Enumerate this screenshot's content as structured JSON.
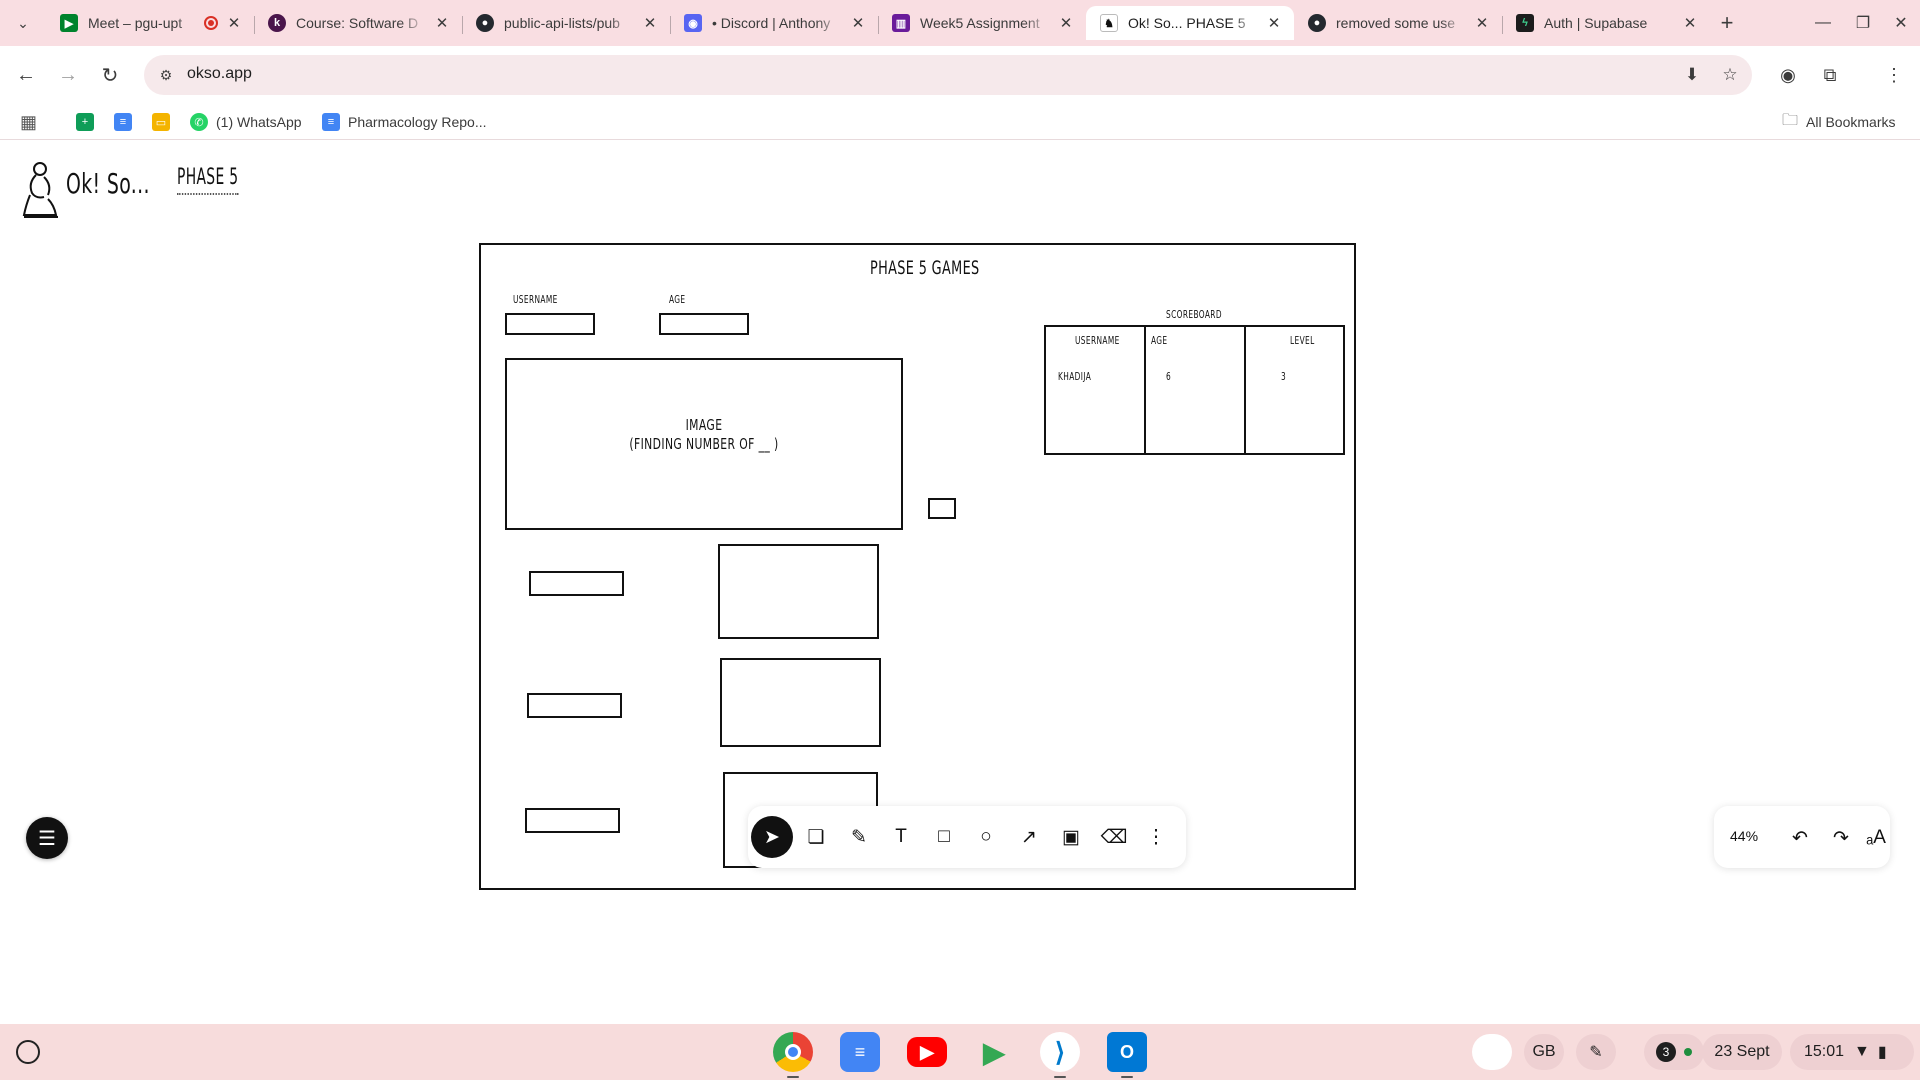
{
  "browser": {
    "tabs": [
      {
        "title": "Meet – pgu-upt",
        "favicon_color": "#00832d",
        "icon": "meet-icon"
      },
      {
        "title": "Course: Software D",
        "favicon_color": "#4a154b",
        "icon": "course-icon"
      },
      {
        "title": "public-api-lists/pub",
        "favicon_color": "#24292f",
        "icon": "github-icon"
      },
      {
        "title": "• Discord | Anthony",
        "favicon_color": "#5865f2",
        "icon": "discord-icon"
      },
      {
        "title": "Week5 Assignment",
        "favicon_color": "#6a1b9a",
        "icon": "doc-icon"
      },
      {
        "title": "Ok! So... PHASE 5",
        "favicon_color": "#ffffff",
        "icon": "okso-icon"
      },
      {
        "title": "removed some use",
        "favicon_color": "#24292f",
        "icon": "github-icon"
      },
      {
        "title": "Auth | Supabase",
        "favicon_color": "#1c1c1c",
        "icon": "supabase-icon"
      }
    ],
    "active_tab_index": 5,
    "url": "okso.app",
    "bookmarks": [
      {
        "label": "",
        "icon": "apps-grid-icon"
      },
      {
        "label": "",
        "icon": "sheets-icon",
        "color": "#0f9d58"
      },
      {
        "label": "",
        "icon": "docs-icon",
        "color": "#4285f4"
      },
      {
        "label": "",
        "icon": "slides-icon",
        "color": "#f4b400"
      },
      {
        "label": "(1) WhatsApp",
        "icon": "whatsapp-icon",
        "color": "#25d366"
      },
      {
        "label": "Pharmacology Repo...",
        "icon": "docs-icon",
        "color": "#4285f4"
      }
    ],
    "all_bookmarks_label": "All Bookmarks"
  },
  "app": {
    "brand": "Ok! So...",
    "board_name": "PHASE 5"
  },
  "canvas": {
    "frame_title": "PHASE 5 GAMES",
    "username_label": "USERNAME",
    "age_label": "AGE",
    "image_text_line1": "IMAGE",
    "image_text_line2": "(FINDING NUMBER OF __ )",
    "scoreboard": {
      "title": "SCOREBOARD",
      "headers": [
        "USERNAME",
        "AGE",
        "LEVEL"
      ],
      "row": [
        "KHADIJA",
        "6",
        "3"
      ]
    }
  },
  "tools": {
    "zoom": "44%",
    "items": [
      "select",
      "frame",
      "pen",
      "text",
      "rectangle",
      "ellipse",
      "arrow",
      "image",
      "eraser",
      "more"
    ]
  },
  "shelf": {
    "lang": "GB",
    "notifications": "3",
    "date": "23 Sept",
    "time": "15:01"
  }
}
